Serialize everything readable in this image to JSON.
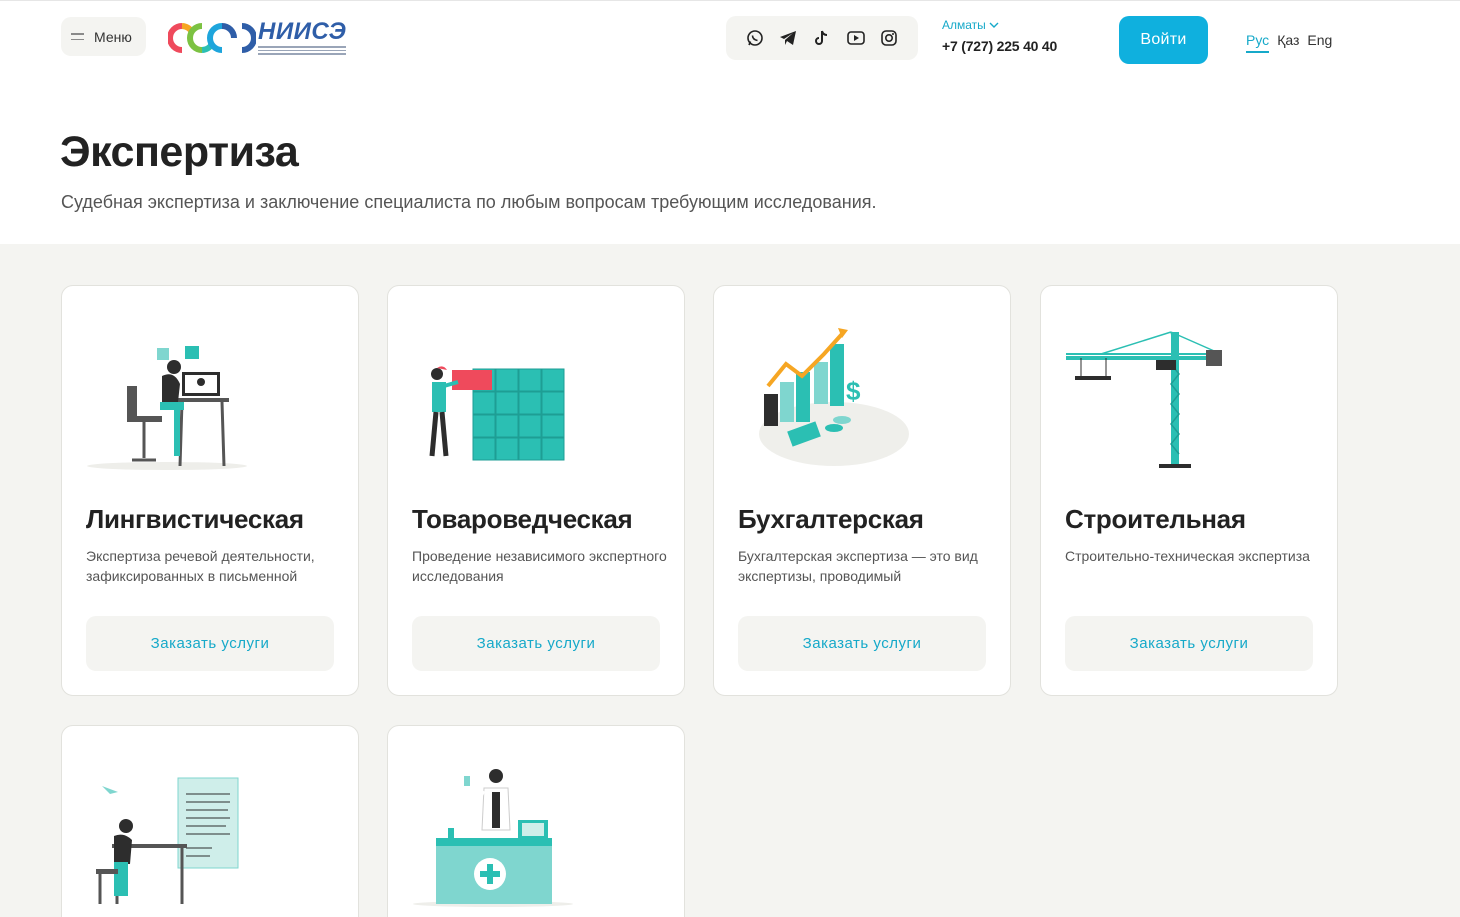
{
  "header": {
    "menu_label": "Меню",
    "logo_text": "НИИСЭ",
    "city": "Алматы",
    "phone": "+7 (727) 225 40 40",
    "login_label": "Войти",
    "languages": [
      {
        "label": "Рус",
        "active": true
      },
      {
        "label": "Қаз",
        "active": false
      },
      {
        "label": "Eng",
        "active": false
      }
    ],
    "social_icons": [
      "whatsapp-icon",
      "telegram-icon",
      "tiktok-icon",
      "youtube-icon",
      "instagram-icon"
    ]
  },
  "hero": {
    "title": "Экспертиза",
    "subtitle": "Судебная экспертиза и заключение специалиста по любым вопросам требующим исследования."
  },
  "cards": [
    {
      "title": "Лингвистическая",
      "description": "Экспертиза речевой деятельности, зафиксированных в письменной",
      "button": "Заказать услуги"
    },
    {
      "title": "Товароведческая",
      "description": "Проведение независимого экспертного исследования",
      "button": "Заказать услуги"
    },
    {
      "title": "Бухгалтерская",
      "description": "Бухгалтерская экспертиза — это вид экспертизы, проводимый",
      "button": "Заказать услуги"
    },
    {
      "title": "Строительная",
      "description": "Строительно-техническая экспертиза",
      "button": "Заказать услуги"
    },
    {
      "title": "",
      "description": "",
      "button": ""
    },
    {
      "title": "",
      "description": "",
      "button": ""
    }
  ],
  "colors": {
    "accent": "#0fb0de",
    "illustration_teal": "#2bbfb3",
    "background": "#f4f4f1"
  }
}
